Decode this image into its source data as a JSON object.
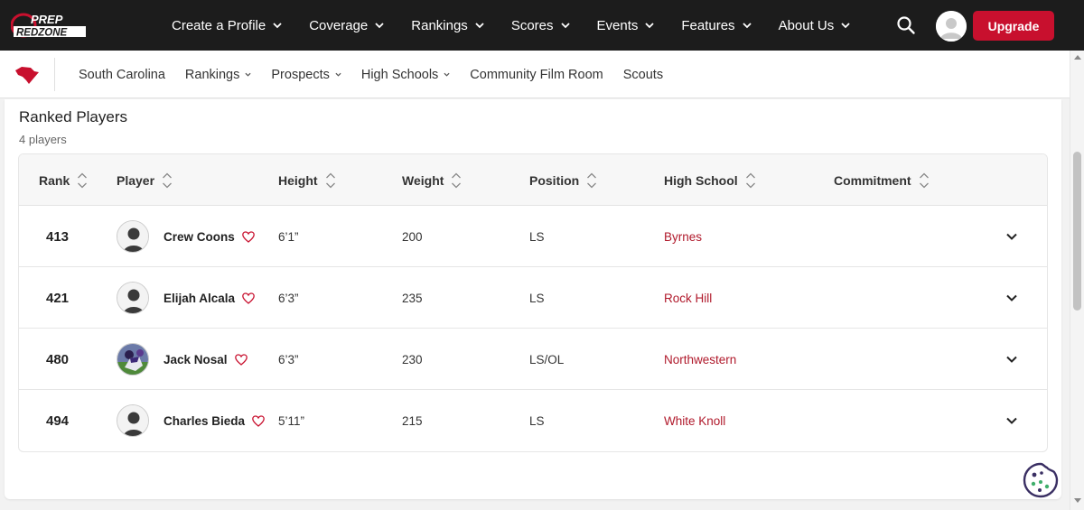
{
  "brand": {
    "logo_top": "PREP",
    "logo_bottom": "REDZONE",
    "accent": "#c8102e",
    "school_color": "#b0192b"
  },
  "topnav": {
    "items": [
      {
        "label": "Create a Profile"
      },
      {
        "label": "Coverage"
      },
      {
        "label": "Rankings"
      },
      {
        "label": "Scores"
      },
      {
        "label": "Events"
      },
      {
        "label": "Features"
      },
      {
        "label": "About Us"
      }
    ],
    "search_icon": "search-icon",
    "upgrade_label": "Upgrade"
  },
  "subnav": {
    "items": [
      {
        "label": "South Carolina",
        "dropdown": false
      },
      {
        "label": "Rankings",
        "dropdown": true
      },
      {
        "label": "Prospects",
        "dropdown": true
      },
      {
        "label": "High Schools",
        "dropdown": true
      },
      {
        "label": "Community Film Room",
        "dropdown": false
      },
      {
        "label": "Scouts",
        "dropdown": false
      }
    ]
  },
  "main": {
    "title": "Ranked Players",
    "count": "4 players",
    "columns": [
      "Rank",
      "Player",
      "Height",
      "Weight",
      "Position",
      "High School",
      "Commitment"
    ],
    "rows": [
      {
        "rank": "413",
        "player": "Crew Coons",
        "height": "6’1”",
        "weight": "200",
        "position": "LS",
        "school": "Byrnes",
        "commitment": "",
        "photo": false
      },
      {
        "rank": "421",
        "player": "Elijah Alcala",
        "height": "6’3”",
        "weight": "235",
        "position": "LS",
        "school": "Rock Hill",
        "commitment": "",
        "photo": false
      },
      {
        "rank": "480",
        "player": "Jack Nosal",
        "height": "6’3”",
        "weight": "230",
        "position": "LS/OL",
        "school": "Northwestern",
        "commitment": "",
        "photo": true
      },
      {
        "rank": "494",
        "player": "Charles Bieda",
        "height": "5’11”",
        "weight": "215",
        "position": "LS",
        "school": "White Knoll",
        "commitment": "",
        "photo": false
      }
    ]
  }
}
